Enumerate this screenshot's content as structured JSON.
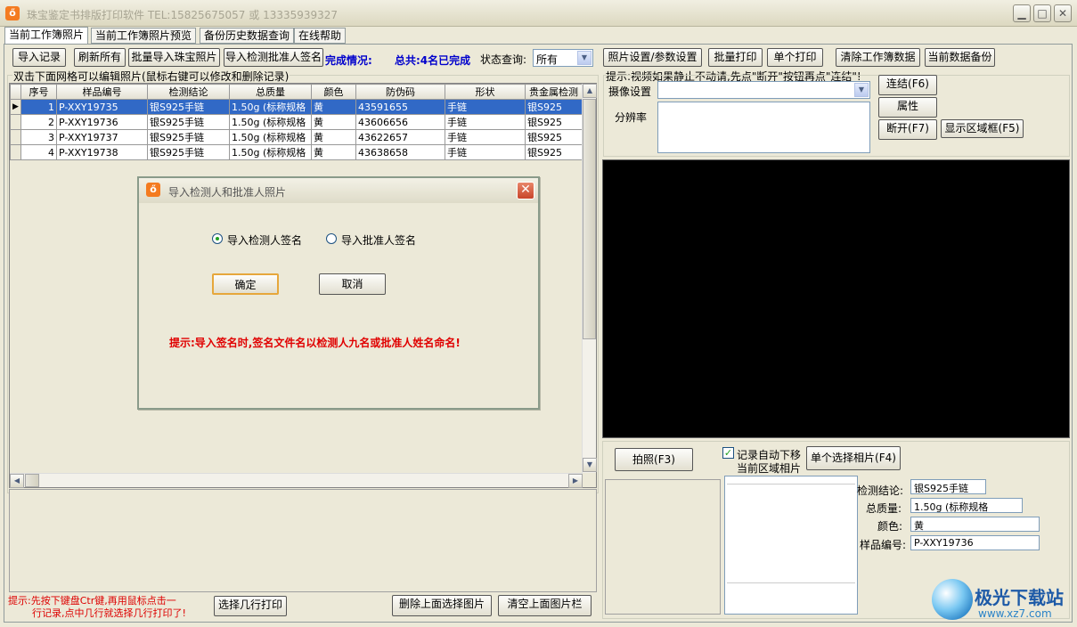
{
  "window": {
    "title": "珠宝鉴定书排版打印软件 TEL:15825675057 或 13335939327",
    "icon_char": "ő",
    "min_glyph": "▁",
    "max_glyph": "□",
    "close_glyph": "✕"
  },
  "tabs": [
    "当前工作簿照片",
    "当前工作簿照片预览",
    "备份历史数据查询",
    "在线帮助"
  ],
  "toolbar": {
    "import_record": "导入记录",
    "refresh_all": "刷新所有",
    "batch_import_photos": "批量导入珠宝照片",
    "import_signature": "导入检测批准人签名",
    "completion_label": "完成情况:",
    "completion_status": "总共:4名已完成",
    "status_query_label": "状态查询:",
    "status_query_value": "所有",
    "photo_settings": "照片设置/参数设置",
    "batch_print": "批量打印",
    "single_print": "单个打印",
    "clear_workbook": "清除工作簿数据",
    "backup_current": "当前数据备份"
  },
  "grid": {
    "caption": "双击下面网格可以编辑照片(鼠标右键可以修改和删除记录)",
    "columns": [
      "序号",
      "样品编号",
      "检测结论",
      "总质量",
      "颜色",
      "防伪码",
      "形状",
      "贵金属检测"
    ],
    "rows": [
      [
        "1",
        "P-XXY19735",
        "银S925手链",
        "1.50g (标称规格",
        "黄",
        "43591655",
        "手链",
        "银S925"
      ],
      [
        "2",
        "P-XXY19736",
        "银S925手链",
        "1.50g (标称规格",
        "黄",
        "43606656",
        "手链",
        "银S925"
      ],
      [
        "3",
        "P-XXY19737",
        "银S925手链",
        "1.50g (标称规格",
        "黄",
        "43622657",
        "手链",
        "银S925"
      ],
      [
        "4",
        "P-XXY19738",
        "银S925手链",
        "1.50g (标称规格",
        "黄",
        "43638658",
        "手链",
        "银S925"
      ]
    ],
    "selected_row": 0
  },
  "dialog": {
    "title": "导入检测人和批准人照片",
    "option_inspector": "导入检测人签名",
    "option_approver": "导入批准人签名",
    "ok": "确定",
    "cancel": "取消",
    "hint": "提示:导入签名时,签名文件名以检测人九名或批准人姓名命名!"
  },
  "bottom_left": {
    "hint_line1": "提示:先按下键盘Ctr键,再用鼠标点击一",
    "hint_line2": "行记录,点中几行就选择几行打印了!",
    "select_rows_print": "选择几行打印",
    "delete_selected_image": "删除上面选择图片",
    "clear_image_bar": "清空上面图片栏"
  },
  "camera": {
    "hint": "提示:视频如果静止不动请,先点\"断开\"按钮再点\"连结\"!",
    "device_label": "摄像设置",
    "device_value": "",
    "resolution_label": "分辨率",
    "connect": "连结(F6)",
    "properties": "属性",
    "disconnect": "断开(F7)",
    "show_region": "显示区域框(F5)"
  },
  "capture": {
    "take_photo": "拍照(F3)",
    "auto_move_checkbox": "记录自动下移",
    "auto_move_checked": true,
    "current_region_photo": "当前区域相片",
    "single_select_photo": "单个选择相片(F4)",
    "conclusion_label": "检测结论:",
    "conclusion_value": "银S925手链",
    "weight_label": "总质量:",
    "weight_value": "1.50g (标称规格",
    "color_label": "颜色:",
    "color_value": "黄",
    "sample_label": "样品编号:",
    "sample_value": "P-XXY19736"
  },
  "watermark": {
    "name": "极光下载站",
    "url": "www.xz7.com"
  }
}
